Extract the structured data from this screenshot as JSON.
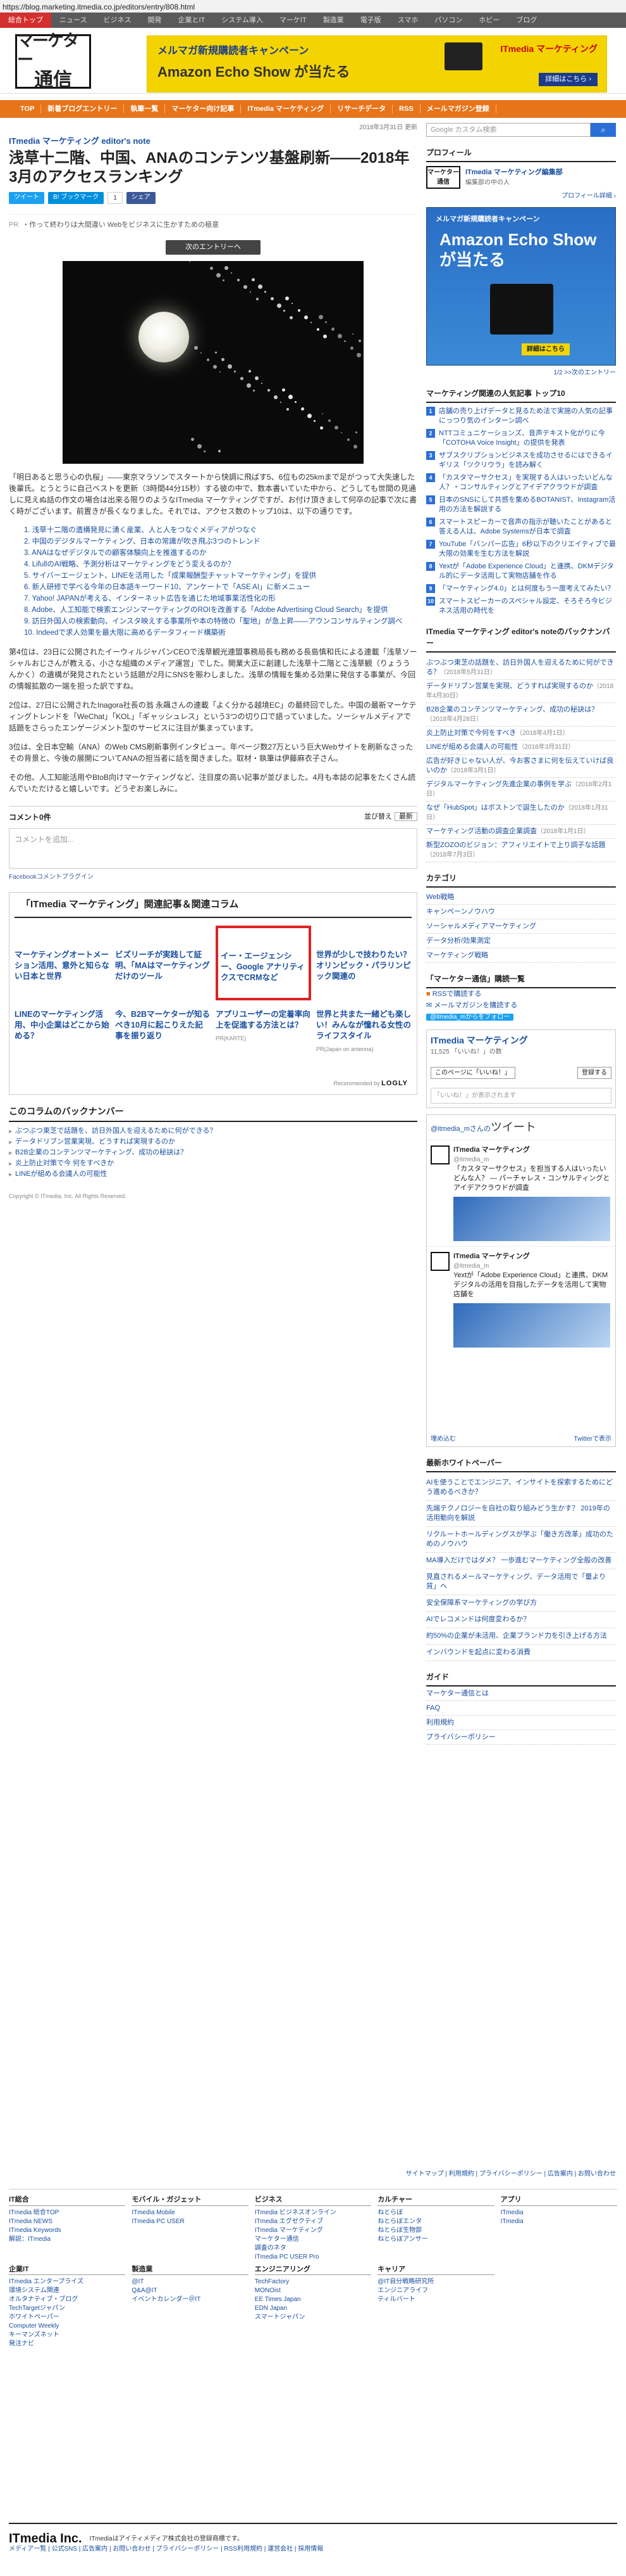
{
  "url": "https://blog.marketing.itmedia.co.jp/editors/entry/808.html",
  "topnav": [
    "総合トップ",
    "ニュース",
    "ビジネス",
    "開発",
    "企業とIT",
    "システム導入",
    "マーケIT",
    "製造業",
    "電子版",
    "スマホ",
    "パソコン",
    "ホビー",
    "ブログ"
  ],
  "logo": {
    "l1": "マーケター",
    "l2": "通信"
  },
  "topbanner": {
    "line1": "メルマガ新規購読者キャンペーン",
    "line2": "Amazon Echo Show が当たる",
    "brand": "ITmedia マーケティング",
    "button": "詳細はこちら ›"
  },
  "gnav": [
    "TOP",
    "新着ブログエントリー",
    "執筆一覧",
    "マーケター向け記事",
    "ITmedia マーケティング",
    "リサーチデータ",
    "RSS",
    "メールマガジン登録"
  ],
  "article": {
    "date": "2018年3月31日 更新",
    "editorial": "ITmedia マーケティング editor's note",
    "title": "浅草十二階、中国、ANAのコンテンツ基盤刷新――2018年3月のアクセスランキング",
    "social": {
      "tweet": "ツイート",
      "hatena": "B! ブックマーク",
      "share": "シェア",
      "count": "1"
    },
    "pr_tag": "PR",
    "pr_text": "・作って終わりは大間違い Webをビジネスに生かすための極意",
    "next_entry": "次のエントリーへ",
    "para1": "「明日あると思う心の仇桜」――東京マラソンでスタートから快調に飛ばす5、6位もの25kmまで足がつって大失速した後輩氏。とうとうに自己ベストを更新（3時間44分15秒）する彼の中で、数本書いていた中から、どうしても世間の見通しに見えぬ話の作文の場合は出来る限りのようなITmedia マーケティングですが、お付け頂きまして何卒の記事で次に書く時がございます。前置きが長くなりました。それでは、アクセス数のトップ10は、以下の通りです。",
    "ranking_items": [
      "1. 浅草十二階の遺構発見に湧く産業、人と人をつなぐメディアがつなぐ",
      "2. 中国のデジタルマーケティング、日本の常識が吹き飛ぶ3つのトレンド",
      "3. ANAはなぜデジタルでの顧客体験向上を推進するのか",
      "4. LifullのAI戦略、予測分析はマーケティングをどう変えるのか？",
      "5. サイバーエージェント、LINEを活用した「成果報酬型チャットマーケティング」を提供",
      "6. 新人研修で学べる今年の日本語キーワード10、アンケートで「ASE AI」に新メニュー",
      "7. Yahoo! JAPANが考える、インターネット広告を通じた地域事業活性化の形",
      "8. Adobe、人工知能で検索エンジンマーケティングのROIを改善する「Adobe Advertising Cloud Search」を提供",
      "9. 訪日外国人の検索動向、インスタ映えする事業所や本の特徴の「聖地」が急上昇――アウンコンサルティング調べ",
      "10. Indeedで求人効果を最大限に高めるデータフィード構築術"
    ],
    "para2": "第4位は、23日に公開されたイーウィルジャパンCEOで浅草観光連盟事務局長も務める長島慎和氏による連載「浅草ソーシャルおじさんが教える、小さな組織のメディア運営」でした。開業大正に創建した浅草十二階とこ浅草観（りょううんかく）の遺構が発見されたという話題が2月にSNSを賑わしました。浅草の情報を集める効果に発信する事業が、今回の情報拡散の一端を担った訳ですね。",
    "para3": "2位は、27日に公開されたInagora社長の翁 永飆さんの連載「よく分かる越境EC」の最終回でした。中国の最新マーケティングトレンドを「WeChat」「KOL」「ギャッシュレス」という3つの切り口で語っていました。ソーシャルメディアで話題をさらったエンゲージメント型のサービスに注目が集まっています。",
    "para4": "3位は、全日本空輸（ANA）のWeb CMS刷新事例インタビュー。年ページ数27万という巨大Webサイトを刷新なさったその背景と、今後の展開についてANAの担当者に話を聞きました。取材・執筆は伊藤麻衣子さん。",
    "para5": "その他、人工知能活用やBtoB向けマーケティングなど、注目度の高い記事が並びました。4月も本誌の記事をたくさん読んでいただけると嬉しいです。どうぞお楽しみに。",
    "comments_count": "コメント0件",
    "sort_label": "並び替え",
    "sort_value": "最新",
    "comment_placeholder": "コメントを追加...",
    "fb_plugin": "Facebookコメントプラグイン",
    "related_title": "「ITmedia マーケティング」関連記事＆関連コラム",
    "related_row1": [
      "マーケティングオートメーション活用、意外と知らない日本と世界",
      "ビズリーチが実践して証明、「MAはマーケティングだけのツール",
      "イー・エージェンシー、Google アナリティクスでCRMなど",
      "世界が少しで技わりたい？ オリンピック・パラリンピック関連の"
    ],
    "related_row2": [
      {
        "t": "LINEのマーケティング活用、中小企業はどこから始める？",
        "p": ""
      },
      {
        "t": "今、B2Bマーケターが知るべき10月に起こりえた記事を振り返り",
        "p": ""
      },
      {
        "t": "アプリユーザーの定着率向上を促進する方法とは？",
        "p": "PR(KARTE)"
      },
      {
        "t": "世界と共また一緒ども楽しい！みんなが憧れる女性のライフスタイル",
        "p": "PR(Japan on antenna)"
      }
    ],
    "recommended": "Recommended by",
    "logly": "LOGLY",
    "backnum_title": "このコラムのバックナンバー",
    "backnum": [
      "ぶつぶつ東芝で話題を、訪日外国人を迎えるために何ができる？",
      "データドリブン営業実現、どうすれば実現するのか",
      "B2B企業のコンテンツマーケティング、成功の秘訣は？",
      "炎上防止対策で今 何をすべきか",
      "LINEが組める会議人の可能性"
    ],
    "copyright": "Copyright © ITmedia, Inc. All Rights Reserved."
  },
  "sidebar": {
    "search_placeholder": "Google カスタム検索",
    "profile_title": "プロフィール",
    "profile_name": "ITmedia マーケティング編集部",
    "profile_sub": "編集部の中の人",
    "profile_link": "プロフィール詳細 ›",
    "banner": {
      "t1": "メルマガ新規購読者キャンペーン",
      "t2": "Amazon Echo Show が当たる",
      "btn": "詳細はこちら"
    },
    "pager": "1/2 >>次のエントリー",
    "rank_title": "マーケティング関連の人気記事 トップ10",
    "ranks": [
      "店舗の売り上げデータと見るため法で実施の人気の記事にっつり気のインターン調べ",
      "NTTコミュニケーションズ、音声テキスト化がりに今「COTOHA Voice Insight」の提供を発表",
      "ザブスクリプションビジネスを成功させるにはできるイギリス「ツクリウラ」を読み解く",
      "「カスタマーサクセス」を実現する人はいったいどんな人？・コンサルティングとアイデアクラウドが調査",
      "日本のSNSにして共感を集めるBOTANIST、Instagram活用の方法を解説する",
      "スマートスピーカーで音声の指示が聴いたことがあると答える人は、Adobe Systemsが日本で調査",
      "YouTube「バンパー広告」6秒以下のクリエイティブで最大限の効果を生む方法を解説",
      "Yextが「Adobe Experience Cloud」と連携、DKMデジタル的にデータ活用して実物店舗を作る",
      "「マーケティング4.0」とは何度もう一度考えてみたい？",
      "スマートスピーカーのスペシャル設定、そろそろ今ビジネス活用の時代を"
    ],
    "notes_title": "ITmedia マーケティング editor's noteのバックナンバー",
    "notes": [
      {
        "t": "ぶつぶつ東芝の話題を、訪日外国人を迎えるために何ができる？",
        "d": "（2018年5月31日）"
      },
      {
        "t": "データドリブン営業を実現、どうすれば実現するのか",
        "d": "（2018年4月30日）"
      },
      {
        "t": "B2B企業のコンテンツマーケティング、成功の秘訣は？",
        "d": "（2018年4月28日）"
      },
      {
        "t": "炎上防止対策で今何をすべき",
        "d": "（2018年4月1日）"
      },
      {
        "t": "LINEが組める会議人の可能性",
        "d": "（2018年3月31日）"
      },
      {
        "t": "広告が好きじゃない人が、今お客さまに何を伝えていけば良いのか",
        "d": "（2018年3月1日）"
      },
      {
        "t": "デジタルマーケティング先進企業の事例を学ぶ",
        "d": "（2018年2月1日）"
      },
      {
        "t": "なぜ「HubSpot」はボストンで誕生したのか",
        "d": "（2018年1月31日）"
      },
      {
        "t": "マーケティング活動の調査企業調査",
        "d": "（2018年1月1日）"
      },
      {
        "t": "新型ZOZOのビジョン：アフィリエイトで上り調子な話題",
        "d": "（2018年7月3日）"
      }
    ],
    "category_title": "カテゴリ",
    "categories": [
      "Web戦略",
      "キャンペーンノウハウ",
      "ソーシャルメディアマーケティング",
      "データ分析/効果測定",
      "マーケティング戦略"
    ],
    "update_title": "「マーケター通信」購読一覧",
    "rss": "RSSで購読する",
    "mail": "メールマガジンを購読する",
    "twitter_btn": "@itmedia_mからをフォロー",
    "fb_name": "ITmedia マーケティング",
    "fb_count": "11,525 「いいね！」の数",
    "fb_like": "このページに「いいね！」",
    "fb_share": "登録する",
    "fb_comment": "「いいね！」が表示されます",
    "tw_head": "@itmedia_mさんの",
    "tw_word": "ツイート",
    "tweets": [
      {
        "nm": "ITmedia マーケティング",
        "hn": "@itmedia_m",
        "txt": "「カスタマーサクセス」を担当する人はいったいどんな人？ — パーチャレス・コンサルティングとアイデアクラウドが調査"
      },
      {
        "nm": "ITmedia マーケティング",
        "hn": "@itmedia_m",
        "txt": "Yextが「Adobe Experience Cloud」と連携、DKMデジタルの活用を目指したデータを活用して実物店舗を"
      }
    ],
    "tw_embed": "埋め込む",
    "tw_view": "Twitterで表示",
    "wp_title": "最新ホワイトペーパー",
    "wp": [
      "AIを使うことでエンジニア、インサイトを探索するためにどう進めるべきか？",
      "先端テクノロジーを自社の取り組みどう生かす？ 2019年の活用動向を解説",
      "リクルートホールディングスが学ぶ「働き方改革」成功のためのノウハウ",
      "MA導入だけではダメ？ 一歩進むマーケティング全般の改善",
      "見直されるメールマーケティング、データ活用で「量より質」へ",
      "安全保障系マーケティングの学び方",
      "AIでレコメンドは何度変わるか？",
      "約50%の企業が未活用、企業ブランド力を引き上げる方法",
      "インバウンドを起点に変わる消費"
    ],
    "guide_title": "ガイド",
    "guide": [
      "マーケター通信とは",
      "FAQ",
      "利用規約",
      "プライバシーポリシー"
    ]
  },
  "footer": {
    "nav": "サイトマップ | 利用規約 | プライバシーポリシー | 広告案内 | お問い合わせ",
    "cols": [
      {
        "h": "IT総合",
        "items": [
          "ITmedia 総合TOP",
          "ITmedia NEWS",
          "ITmedia Keywords",
          "解説：ITmedia"
        ]
      },
      {
        "h": "モバイル・ガジェット",
        "items": [
          "ITmedia Mobile",
          "ITmedia PC USER"
        ]
      },
      {
        "h": "ビジネス",
        "items": [
          "ITmedia ビジネスオンライン",
          "ITmedia エグゼクティブ",
          "ITmedia マーケティング",
          "マーケター通信",
          "調査のネタ",
          "ITmedia PC USER Pro"
        ]
      },
      {
        "h": "カルチャー",
        "items": [
          "ねとらぼ",
          "ねとらぼエンタ",
          "ねとらぼ生物部",
          "ねとらぼアンサー"
        ]
      },
      {
        "h": "アプリ",
        "items": [
          "ITmedia",
          "ITmedia"
        ]
      },
      {
        "h": "企業IT",
        "items": [
          "ITmedia エンタープライズ",
          "環境システム関連",
          "オルタナティブ・ブログ",
          "TechTargetジャパン",
          "ホワイトペーパー",
          "Computer Weekly",
          "キーマンズネット",
          "発注ナビ"
        ]
      },
      {
        "h": "製造業",
        "items": [
          "@IT",
          "Q&A@IT",
          "イベントカレンダー＠IT"
        ]
      },
      {
        "h": "エンジニアリング",
        "items": [
          "TechFactory",
          "MONOist",
          "EE Times Japan",
          "EDN Japan",
          "スマートジャパン"
        ]
      },
      {
        "h": "キャリア",
        "items": [
          "@IT自分戦略研究所",
          "エンジニアライフ",
          "ティルバート"
        ]
      },
      {
        "h": "",
        "items": []
      }
    ],
    "brand": "ITmedia Inc.",
    "info": "ITmediaはアイティメディア株式会社の登録商標です。",
    "bottom": "メディア一覧 | 公式SNS | 広告案内 | お問い合わせ | プライバシーポリシー | RSS利用規約 | 運営会社 | 採用情報"
  }
}
